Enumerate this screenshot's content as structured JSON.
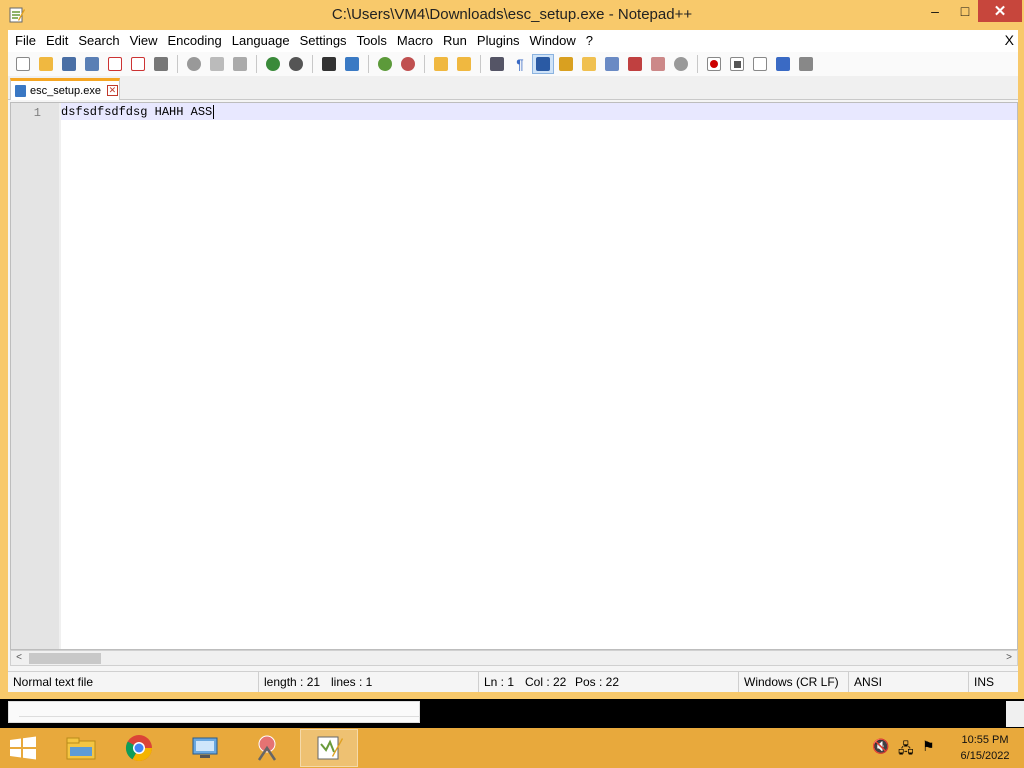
{
  "window": {
    "title": "C:\\Users\\VM4\\Downloads\\esc_setup.exe - Notepad++",
    "minimize": "–",
    "maximize": "□",
    "close": "✕"
  },
  "menubar": {
    "items": [
      "File",
      "Edit",
      "Search",
      "View",
      "Encoding",
      "Language",
      "Settings",
      "Tools",
      "Macro",
      "Run",
      "Plugins",
      "Window",
      "?"
    ],
    "close_doc": "X"
  },
  "toolbar": {
    "icons": [
      "new-file-icon",
      "open-file-icon",
      "save-icon",
      "save-all-icon",
      "close-icon",
      "close-all-icon",
      "print-icon",
      "cut-icon",
      "copy-icon",
      "paste-icon",
      "undo-icon",
      "redo-icon",
      "find-icon",
      "replace-icon",
      "zoom-in-icon",
      "zoom-out-icon",
      "sync-vertical-icon",
      "sync-horizontal-icon",
      "word-wrap-icon",
      "show-all-chars-icon",
      "indent-guide-icon",
      "user-language-icon",
      "doc-map-icon",
      "function-list-icon",
      "folder-workspace-icon",
      "monitoring-icon",
      "record-macro-icon",
      "stop-record-icon",
      "playback-macro-icon",
      "run-macro-multiple-icon",
      "save-macro-icon"
    ]
  },
  "tab": {
    "label": "esc_setup.exe",
    "close": "✕"
  },
  "editor": {
    "line_number": "1",
    "content": "dsfsdfsdfdsg HAHH ASS"
  },
  "statusbar": {
    "file_type": "Normal text file",
    "length": "length : 21",
    "lines": "lines : 1",
    "ln": "Ln : 1",
    "col": "Col : 22",
    "pos": "Pos : 22",
    "eol": "Windows (CR LF)",
    "encoding": "ANSI",
    "mode": "INS"
  },
  "scrollbar": {
    "left": "<",
    "right": ">"
  },
  "taskbar": {
    "apps": [
      "file-explorer-icon",
      "chrome-icon",
      "remote-desktop-icon",
      "snipping-tool-icon",
      "notepadpp-icon"
    ],
    "tray": [
      "volume-muted-icon",
      "network-icon",
      "flag-icon"
    ],
    "time": "10:55 PM",
    "date": "6/15/2022"
  },
  "colors": {
    "frame": "#f8c96b",
    "taskbar": "#e8a93c",
    "current_line": "#e8e8ff",
    "close_red": "#c7463c"
  }
}
